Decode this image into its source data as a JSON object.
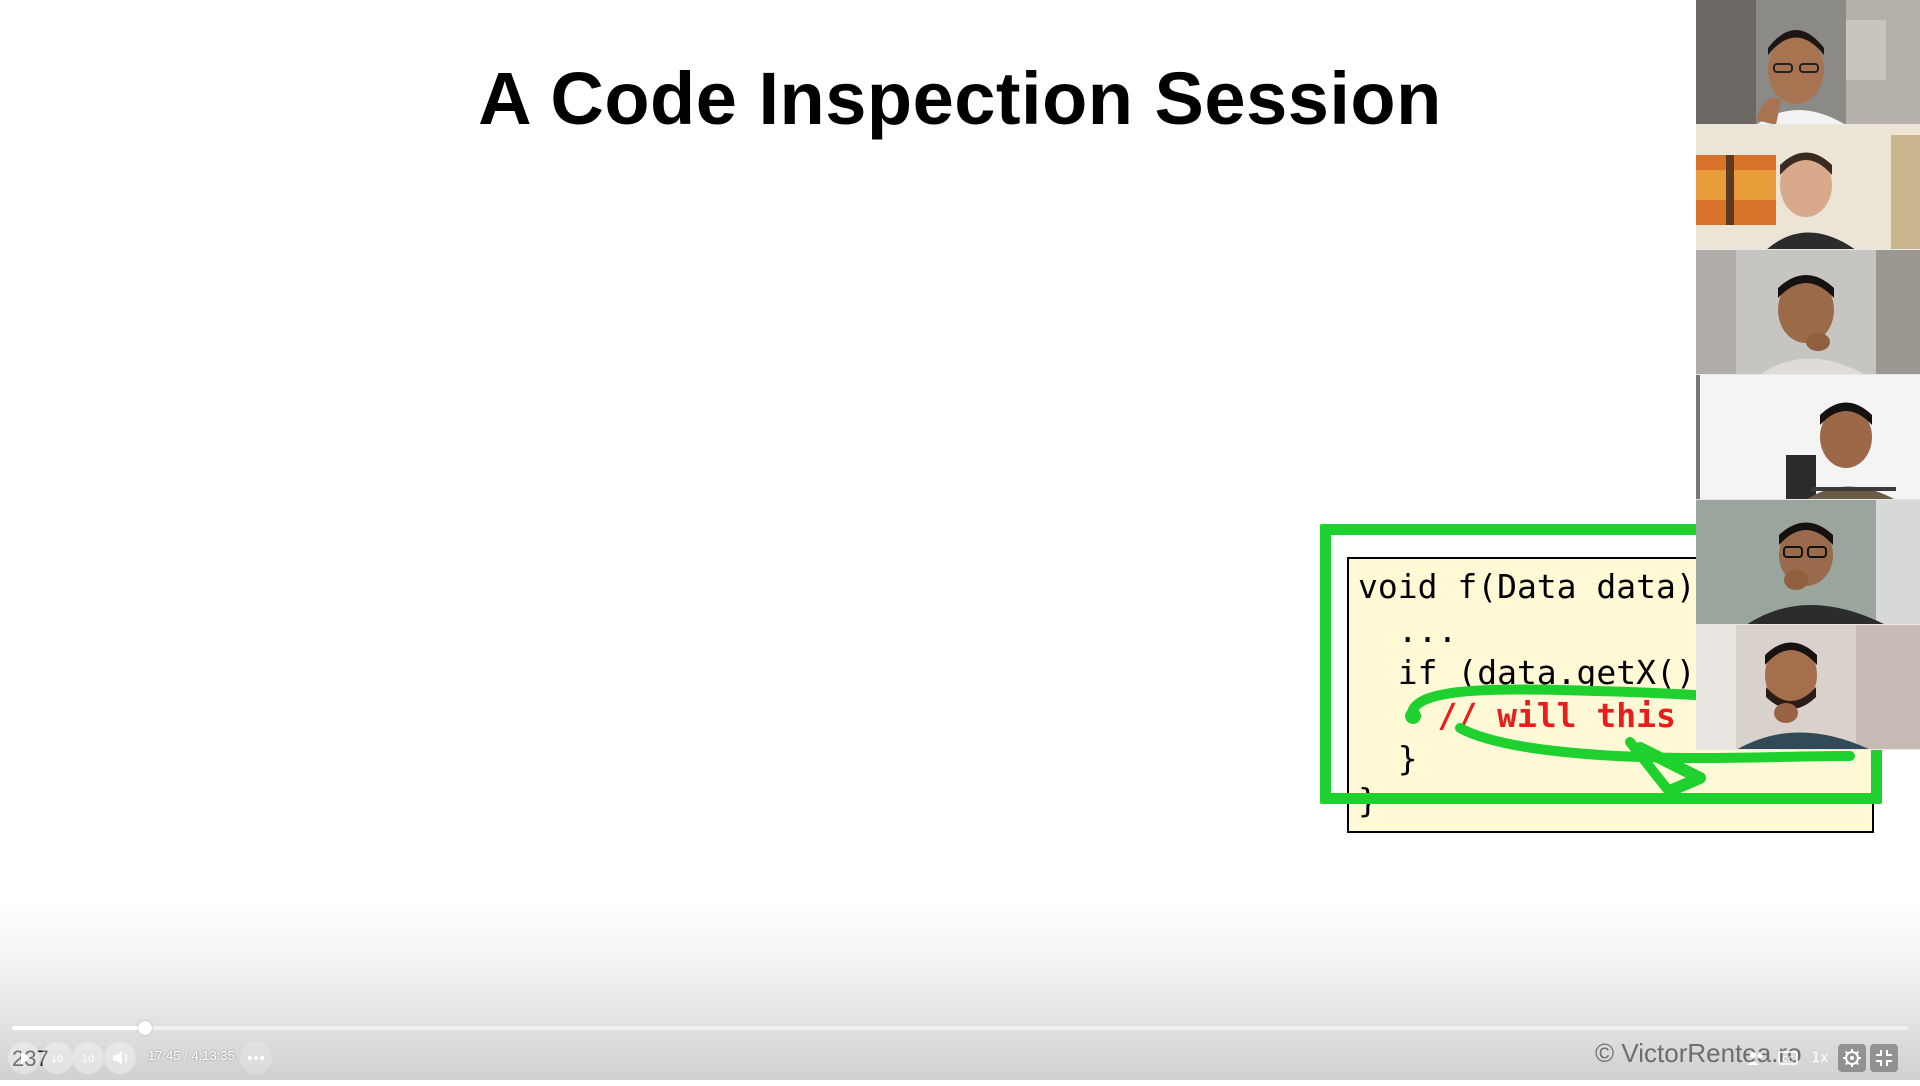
{
  "slide": {
    "title": "A Code Inspection Session",
    "number": "237",
    "code_lines": [
      "void f(Data data)",
      "  ...",
      "  if (data.getX()",
      "    // will this",
      "  }",
      "}"
    ]
  },
  "player": {
    "time": "17:45 / 4:13:35",
    "progress": 0.0702,
    "speed_label": "1x",
    "watermark": "© VictorRentea.ro",
    "skip_back_label": "10",
    "skip_forward_label": "10"
  },
  "participants": {
    "count": 6
  },
  "colors": {
    "highlight_green": "#1fd12f",
    "comment_red": "#ea1c1c",
    "code_background": "#fff9d6"
  }
}
